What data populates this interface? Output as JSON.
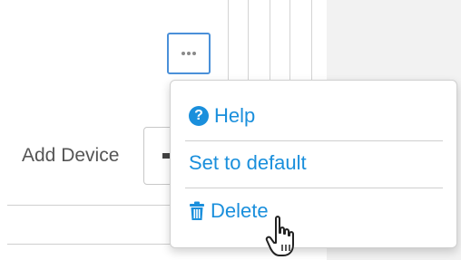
{
  "toolbar": {
    "more_icon": "ellipsis-icon"
  },
  "form": {
    "add_device_label": "Add Device"
  },
  "menu": {
    "items": [
      {
        "label": "Help",
        "icon": "question-circle-icon"
      },
      {
        "label": "Set to default",
        "icon": ""
      },
      {
        "label": "Delete",
        "icon": "trash-icon"
      }
    ]
  },
  "colors": {
    "accent": "#1a8fdc",
    "button_border": "#4a90d9",
    "panel_bg": "#f2f2f2"
  },
  "cursor": {
    "type": "pointer-hand"
  }
}
